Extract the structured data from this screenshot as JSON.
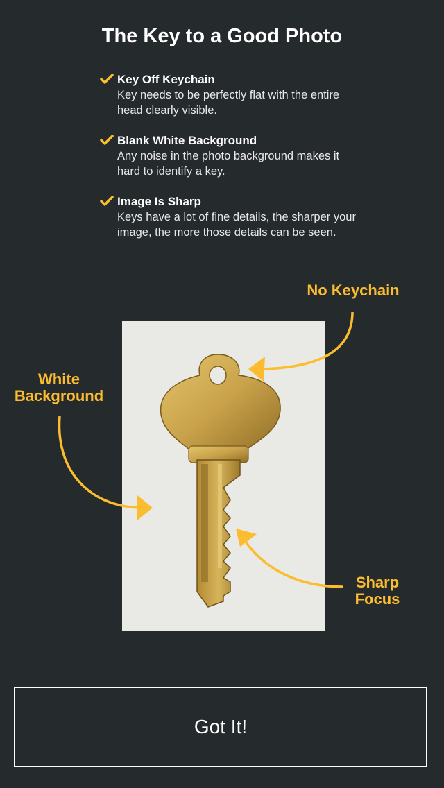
{
  "header": {
    "title": "The Key to a Good Photo"
  },
  "tips": [
    {
      "icon": "checkmark-icon",
      "title": "Key Off Keychain",
      "description": "Key needs to be perfectly flat with the entire head clearly visible."
    },
    {
      "icon": "checkmark-icon",
      "title": "Blank White Background",
      "description": "Any noise in the photo background makes it hard to identify a key."
    },
    {
      "icon": "checkmark-icon",
      "title": "Image Is Sharp",
      "description": "Keys have a lot of fine details, the sharper your image, the more those details can be seen."
    }
  ],
  "callouts": {
    "no_keychain": "No Keychain",
    "white_background_line1": "White",
    "white_background_line2": "Background",
    "sharp_focus_line1": "Sharp",
    "sharp_focus_line2": "Focus"
  },
  "button": {
    "label": "Got It!"
  },
  "colors": {
    "background": "#252a2d",
    "accent": "#fbbd2f",
    "text": "#ffffff",
    "photo_background": "#e9e9e6",
    "key_gold": "#c9a24a"
  }
}
